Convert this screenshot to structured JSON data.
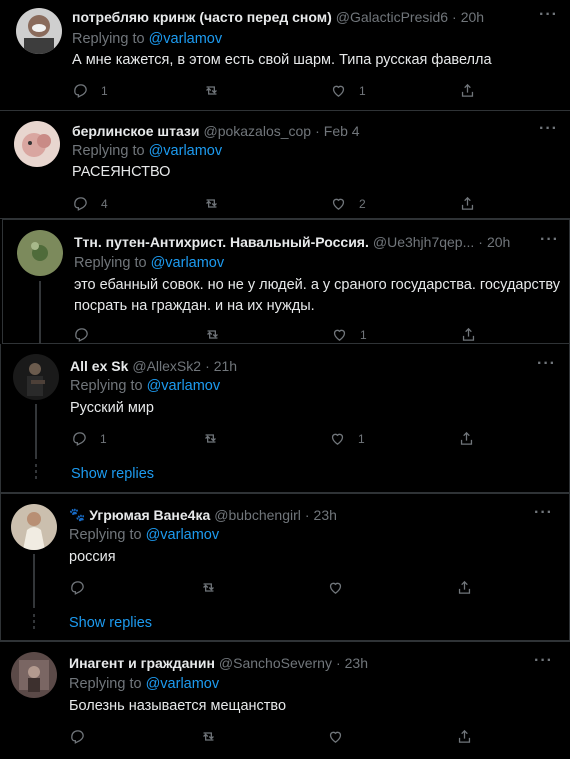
{
  "replying_prefix": "Replying to ",
  "tweets": [
    {
      "name": "потребляю кринж (часто перед сном)",
      "handle": "@GalacticPresid6",
      "time": "20h",
      "mention": "@varlamov",
      "text": "А мне кажется, в этом есть свой шарм. Типа русская фавелла",
      "reply_count": "1",
      "retweet_count": "",
      "like_count": "1"
    },
    {
      "name": "берлинское штази",
      "handle": "@pokazalos_cop",
      "time": "Feb 4",
      "mention": "@varlamov",
      "text": "РАСЕЯНСТВО",
      "reply_count": "4",
      "retweet_count": "",
      "like_count": "2"
    },
    {
      "name": "Ттн. путен-Антихрист. Навальный-Россия.",
      "handle": "@Ue3hjh7qep...",
      "time": "20h",
      "mention": "@varlamov",
      "text_line1": "это ебанный совок. но не у людей. а у сраного государства. государству",
      "text_line2": "посрать на граждан. и на их нужды.",
      "reply_count": "",
      "retweet_count": "",
      "like_count": "1"
    },
    {
      "name": "All ex Sk",
      "handle": "@AllexSk2",
      "time": "21h",
      "mention": "@varlamov",
      "text": "Русский мир",
      "reply_count": "1",
      "retweet_count": "",
      "like_count": "1",
      "show_replies": "Show replies"
    },
    {
      "emoji": "🐾",
      "name": "Угрюмая Ване4ка",
      "handle": "@bubchengirl",
      "time": "23h",
      "mention": "@varlamov",
      "text": "россия",
      "reply_count": "",
      "retweet_count": "",
      "like_count": "",
      "show_replies": "Show replies"
    },
    {
      "name": "Инагент и гражданин",
      "handle": "@SanchoSeverny",
      "time": "23h",
      "mention": "@varlamov",
      "text": "Болезнь называется мещанство",
      "reply_count": "",
      "retweet_count": "",
      "like_count": ""
    }
  ],
  "colors": {
    "background": "#000000",
    "text": "#e7e9ea",
    "muted": "#71767b",
    "accent": "#1d9bf0",
    "border": "#2f3336"
  },
  "icons": [
    "reply-icon",
    "retweet-icon",
    "like-icon",
    "share-icon",
    "more-icon"
  ]
}
